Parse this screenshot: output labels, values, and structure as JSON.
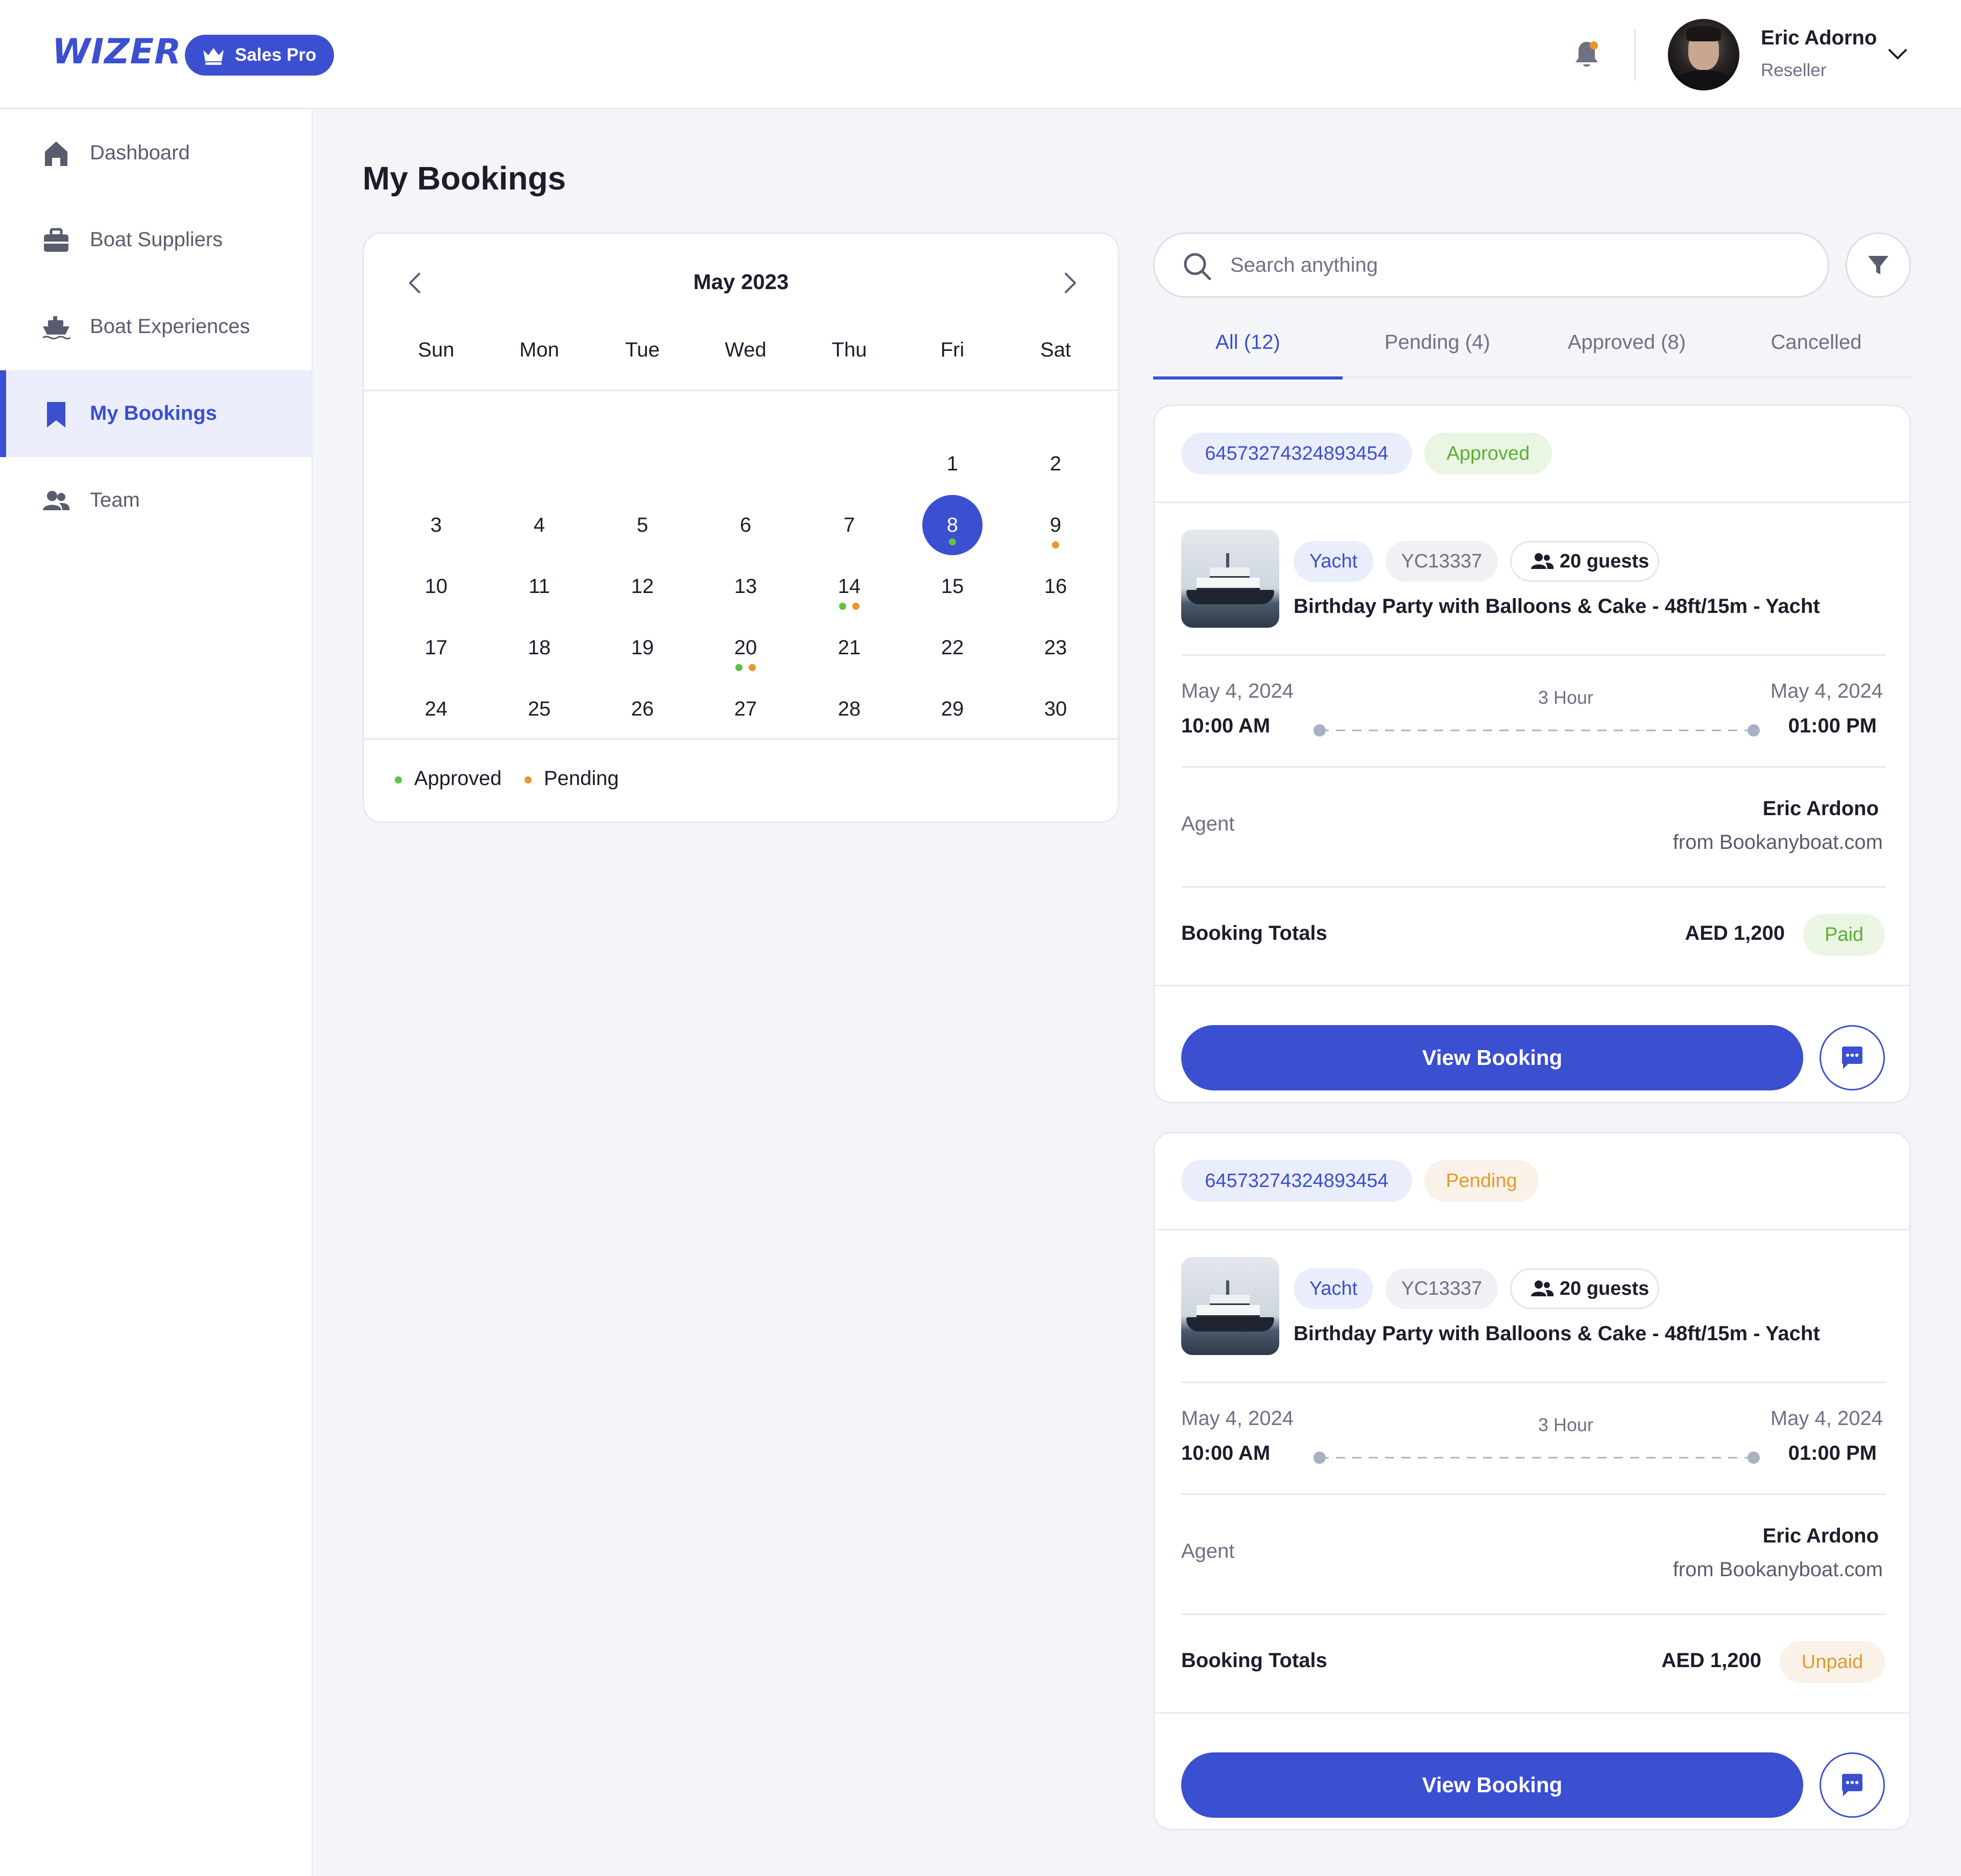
{
  "header": {
    "logo": "WIZER",
    "plan_badge": "Sales Pro",
    "user": {
      "name": "Eric Adorno",
      "role": "Reseller"
    }
  },
  "sidebar": {
    "items": [
      {
        "label": "Dashboard",
        "icon": "home-icon",
        "active": false
      },
      {
        "label": "Boat Suppliers",
        "icon": "briefcase-icon",
        "active": false
      },
      {
        "label": "Boat Experiences",
        "icon": "ship-icon",
        "active": false
      },
      {
        "label": "My Bookings",
        "icon": "bookmark-icon",
        "active": true
      },
      {
        "label": "Team",
        "icon": "people-icon",
        "active": false
      }
    ]
  },
  "page": {
    "title": "My Bookings"
  },
  "calendar": {
    "month_label": "May 2023",
    "weekdays": [
      "Sun",
      "Mon",
      "Tue",
      "Wed",
      "Thu",
      "Fri",
      "Sat"
    ],
    "first_weekday_index": 5,
    "days_in_month": 30,
    "selected_day": 8,
    "markers": {
      "8": [
        "approved"
      ],
      "9": [
        "pending"
      ],
      "14": [
        "approved",
        "pending"
      ],
      "20": [
        "approved",
        "pending"
      ]
    },
    "legend": {
      "approved": "Approved",
      "pending": "Pending"
    }
  },
  "colors": {
    "accent": "#3b4fd1",
    "approved": "#5fc246",
    "pending": "#e9962b"
  },
  "search": {
    "placeholder": "Search anything"
  },
  "tabs": [
    {
      "label": "All (12)",
      "active": true
    },
    {
      "label": "Pending (4)",
      "active": false
    },
    {
      "label": "Approved (8)",
      "active": false
    },
    {
      "label": "Cancelled",
      "active": false
    }
  ],
  "bookings": [
    {
      "id": "64573274324893454",
      "status": "Approved",
      "type": "Yacht",
      "code": "YC13337",
      "guests": "20 guests",
      "title": "Birthday Party with Balloons & Cake - 48ft/15m - Yacht",
      "start_date": "May 4, 2024",
      "start_time": "10:00 AM",
      "duration": "3 Hour",
      "end_date": "May 4, 2024",
      "end_time": "01:00 PM",
      "agent_label": "Agent",
      "agent_name": "Eric Ardono",
      "agent_from": "from Bookanyboat.com",
      "totals_label": "Booking Totals",
      "total": "AED 1,200",
      "payment": "Paid",
      "view_label": "View Booking"
    },
    {
      "id": "64573274324893454",
      "status": "Pending",
      "type": "Yacht",
      "code": "YC13337",
      "guests": "20 guests",
      "title": "Birthday Party with Balloons & Cake - 48ft/15m - Yacht",
      "start_date": "May 4, 2024",
      "start_time": "10:00 AM",
      "duration": "3 Hour",
      "end_date": "May 4, 2024",
      "end_time": "01:00 PM",
      "agent_label": "Agent",
      "agent_name": "Eric Ardono",
      "agent_from": "from Bookanyboat.com",
      "totals_label": "Booking Totals",
      "total": "AED 1,200",
      "payment": "Unpaid",
      "view_label": "View Booking"
    }
  ]
}
